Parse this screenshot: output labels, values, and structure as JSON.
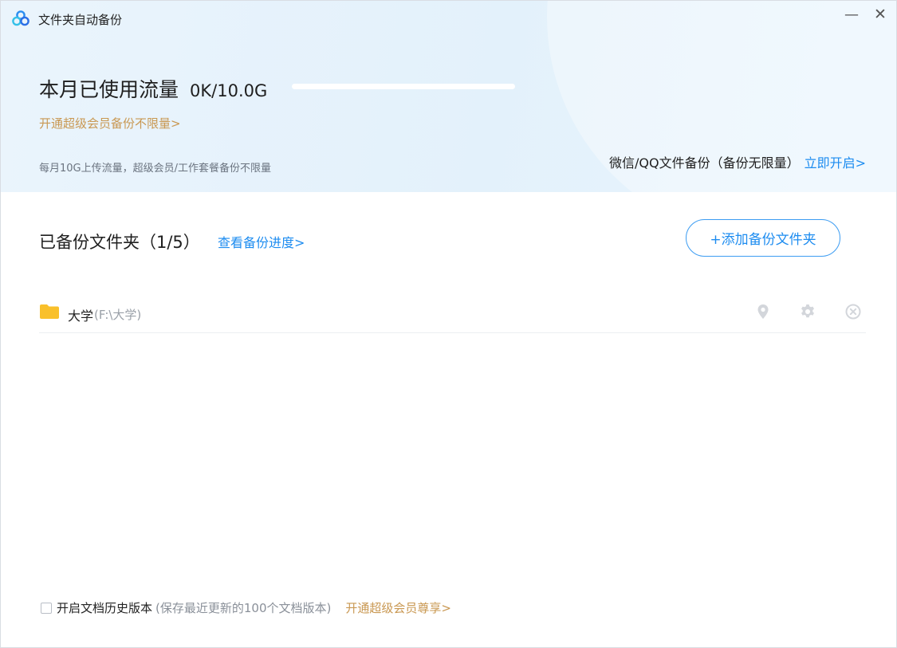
{
  "window": {
    "title": "文件夹自动备份",
    "minimize_symbol": "—",
    "close_symbol": "✕"
  },
  "usage": {
    "title": "本月已使用流量",
    "value": "0K/10.0G",
    "used_fraction": 0.0,
    "vip_link": "开通超级会员备份不限量>",
    "quota_note": "每月10G上传流量，超级会员/工作套餐备份不限量"
  },
  "wechat_backup": {
    "text": "微信/QQ文件备份（备份无限量）",
    "link": "立即开启>"
  },
  "backup_section": {
    "title": "已备份文件夹（1/5）",
    "progress_link": "查看备份进度>",
    "add_button": "+添加备份文件夹",
    "folders": [
      {
        "name": "大学",
        "path": "(F:\\大学)"
      }
    ]
  },
  "footer": {
    "history_label": "开启文档历史版本",
    "history_note": "(保存最近更新的100个文档版本)",
    "history_vip_link": "开通超级会员尊享>"
  },
  "icons": {
    "app_logo": "cloud-logo-icon",
    "folder": "folder-icon",
    "location": "location-pin-icon",
    "settings": "gear-icon",
    "remove": "remove-circle-icon"
  },
  "colors": {
    "accent_blue": "#1d8cf0",
    "vip_gold": "#c99852",
    "folder_yellow": "#f9c02b",
    "banner_bg": "#e3f1fb",
    "muted_icon": "#cfd3d9"
  }
}
